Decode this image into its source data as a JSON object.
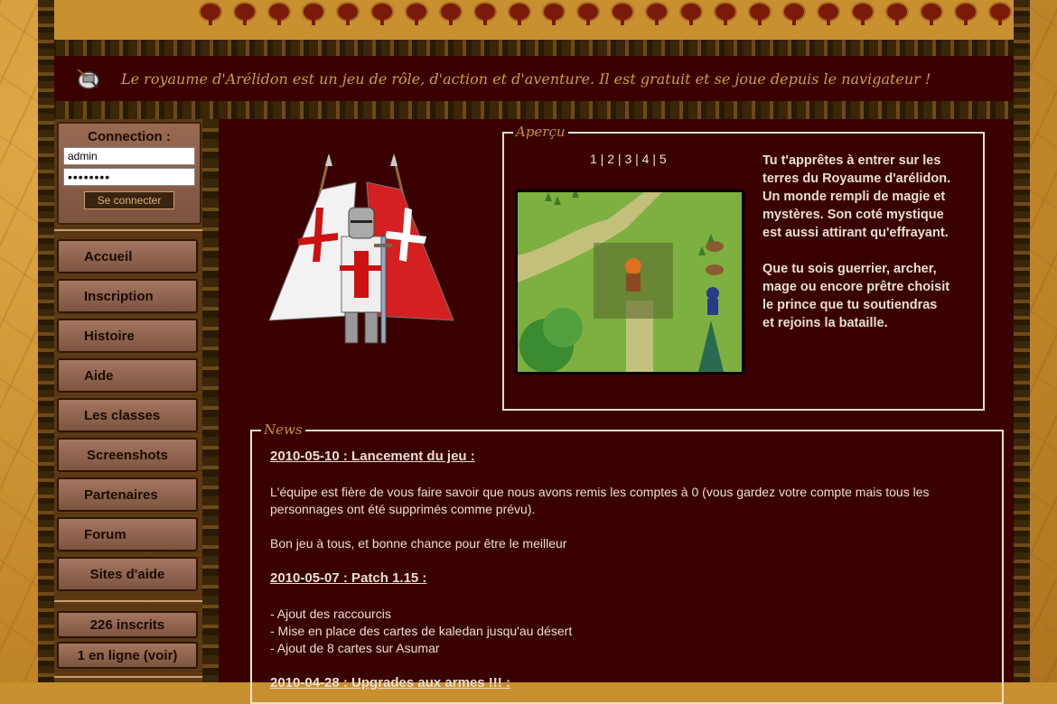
{
  "header": {
    "tagline": "Le royaume d'Arélidon est un jeu de rôle, d'action et d'aventure. Il est gratuit et se joue depuis le navigateur !"
  },
  "login": {
    "title": "Connection :",
    "username_value": "admin",
    "password_value": "••••••••",
    "button_label": "Se connecter"
  },
  "nav": {
    "items": [
      "Accueil",
      "Inscription",
      "Histoire",
      "Aide",
      "Les classes",
      "Screenshots",
      "Partenaires",
      "Forum",
      "Sites d'aide"
    ]
  },
  "stats": {
    "registered": "226 inscrits",
    "online": "1 en ligne (voir)"
  },
  "apercu": {
    "legend": "Aperçu",
    "pages": [
      "1",
      "2",
      "3",
      "4",
      "5"
    ],
    "text1": "Tu t'apprêtes à entrer sur les terres du Royaume d'arélidon. Un monde rempli de magie et mystères. Son coté mystique est aussi attirant qu'effrayant.",
    "text2": "Que tu sois guerrier, archer, mage ou encore prêtre choisit le prince que tu soutiendras et rejoins la bataille."
  },
  "news": {
    "legend": "News",
    "items": [
      {
        "title": "2010-05-10 : Lancement du jeu :",
        "para1": "L'équipe est fière de vous faire savoir que nous avons remis les comptes à 0 (vous gardez votre compte mais tous les personnages ont été supprimés comme prévu).",
        "para2": "Bon jeu à tous, et bonne chance pour être le meilleur"
      },
      {
        "title": "2010-05-07 : Patch 1.15 :",
        "line1": "- Ajout des raccourcis",
        "line2": "- Mise en place des cartes de kaledan jusqu'au désert",
        "line3": "- Ajout de 8 cartes sur Asumar"
      },
      {
        "title": "2010-04-28 : Upgrades aux armes !!! :"
      }
    ]
  },
  "colors": {
    "main_bg": "#3a0000",
    "accent_gold": "#d29a45",
    "text_light": "#e8e0d0"
  }
}
